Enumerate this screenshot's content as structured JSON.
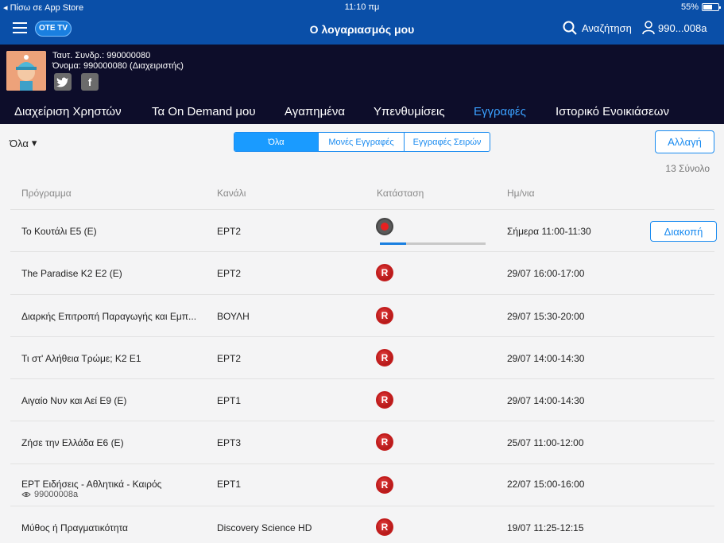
{
  "status_bar": {
    "back_label": "Πίσω σε App Store",
    "time": "11:10 πμ",
    "battery": "55%"
  },
  "navbar": {
    "logo_text": "OTE TV",
    "title": "Ο λογαριασμός μου",
    "search_label": "Αναζήτηση",
    "user_label": "990...008a"
  },
  "account": {
    "subscriber_id": "Ταυτ. Συνδρ.: 990000080",
    "name": "Όνομα: 990000080 (Διαχειριστής)",
    "twitter": "twitter-icon",
    "facebook": "facebook-icon"
  },
  "tabs": [
    {
      "label": "Διαχείριση Χρηστών",
      "active": false
    },
    {
      "label": "Τα On Demand μου",
      "active": false
    },
    {
      "label": "Αγαπημένα",
      "active": false
    },
    {
      "label": "Υπενθυμίσεις",
      "active": false
    },
    {
      "label": "Εγγραφές",
      "active": true
    },
    {
      "label": "Ιστορικό Ενοικιάσεων",
      "active": false
    }
  ],
  "filter": {
    "selected": "Όλα"
  },
  "segments": [
    {
      "label": "Όλα",
      "active": true
    },
    {
      "label": "Μονές Εγγραφές",
      "active": false
    },
    {
      "label": "Εγγραφές Σειρών",
      "active": false
    }
  ],
  "change_button": "Αλλαγή",
  "total": "13 Σύνολο",
  "columns": {
    "program": "Πρόγραμμα",
    "channel": "Κανάλι",
    "status": "Κατάσταση",
    "date": "Ημ/νια"
  },
  "rows": [
    {
      "program": "Το Κουτάλι Ε5 (Ε)",
      "channel": "ΕΡΤ2",
      "status": "recording",
      "progress": 0.25,
      "date": "Σήμερα 11:00-11:30",
      "action": "Διακοπή"
    },
    {
      "program": "The Paradise K2 E2 (E)",
      "channel": "ΕΡΤ2",
      "status": "R",
      "date": "29/07 16:00-17:00"
    },
    {
      "program": "Διαρκής Επιτροπή Παραγωγής και Εμπ...",
      "channel": "ΒΟΥΛΗ",
      "status": "R",
      "date": "29/07 15:30-20:00"
    },
    {
      "program": "Τι στ' Αλήθεια Τρώμε; Κ2 Ε1",
      "channel": "ΕΡΤ2",
      "status": "R",
      "date": "29/07 14:00-14:30"
    },
    {
      "program": "Αιγαίο Νυν και Αεί Ε9 (Ε)",
      "channel": "ΕΡΤ1",
      "status": "R",
      "date": "29/07 14:00-14:30"
    },
    {
      "program": "Ζήσε την Ελλάδα Ε6 (Ε)",
      "channel": "ΕΡΤ3",
      "status": "R",
      "date": "25/07 11:00-12:00"
    },
    {
      "program": "ΕΡΤ Ειδήσεις - Αθλητικά - Καιρός",
      "channel": "ΕΡΤ1",
      "status": "R",
      "date": "22/07 15:00-16:00",
      "sub": "99000008a"
    },
    {
      "program": "Μύθος ή Πραγματικότητα",
      "channel": "Discovery Science HD",
      "status": "R",
      "date": "19/07 11:25-12:15"
    }
  ]
}
